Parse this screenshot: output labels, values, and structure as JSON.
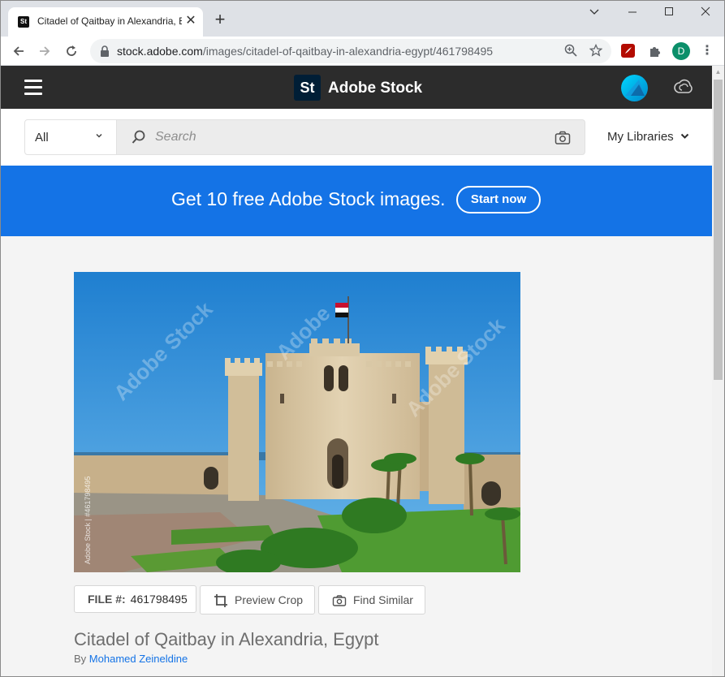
{
  "browser": {
    "tab_title": "Citadel of Qaitbay in Alexandria, E",
    "tab_favicon": "St",
    "url_host": "stock.adobe.com",
    "url_path": "/images/citadel-of-qaitbay-in-alexandria-egypt/461798495",
    "profile_initial": "D"
  },
  "header": {
    "logo_text": "St",
    "brand": "Adobe Stock"
  },
  "search": {
    "category": "All",
    "placeholder": "Search",
    "libraries_label": "My Libraries"
  },
  "promo": {
    "text": "Get 10 free Adobe Stock images.",
    "button": "Start now"
  },
  "asset": {
    "file_label": "FILE #:",
    "file_number": "461798495",
    "preview_crop": "Preview Crop",
    "find_similar": "Find Similar",
    "title": "Citadel of Qaitbay in Alexandria, Egypt",
    "by_label": "By",
    "author": "Mohamed Zeineldine",
    "watermark": "Adobe Stock",
    "side_credit": "Adobe Stock | #461798495"
  },
  "icons": {
    "tab_close": "close-icon",
    "new_tab": "plus-icon",
    "back": "arrow-left-icon",
    "forward": "arrow-right-icon",
    "reload": "reload-icon",
    "lock": "lock-icon",
    "zoom": "zoom-icon",
    "bookmark": "star-icon",
    "pdf": "pdf-extension-icon",
    "extensions": "puzzle-icon",
    "menu": "hamburger-icon",
    "creative_cloud": "creative-cloud-icon",
    "search": "search-icon",
    "visual_search": "camera-icon",
    "crop": "crop-icon"
  },
  "colors": {
    "adobe_header": "#2c2c2c",
    "promo_blue": "#1473e6",
    "link_blue": "#1473e6",
    "sky": "#2f8fd8",
    "stone": "#d8c7a6"
  }
}
